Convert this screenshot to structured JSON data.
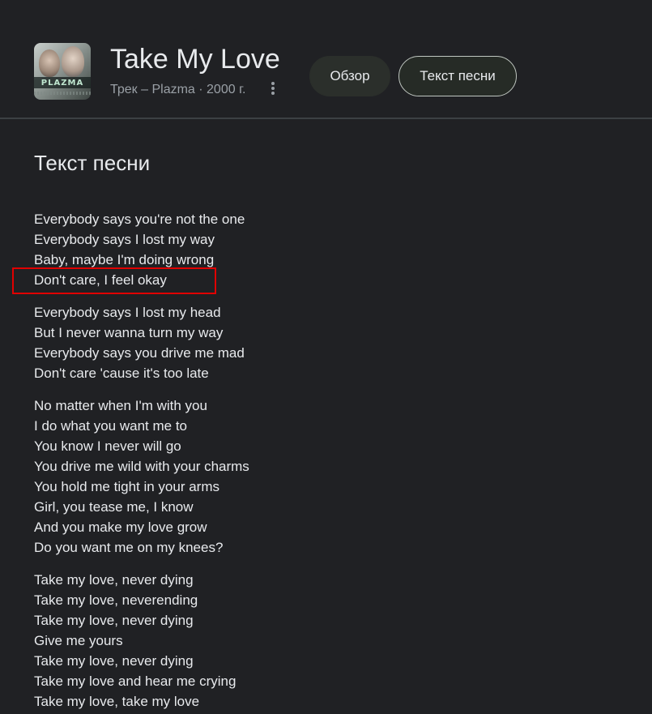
{
  "header": {
    "title": "Take My Love",
    "meta": "Трек – Plazma · 2000 г.",
    "album_art_text": "PLAZMA",
    "more_icon": "more-vert-icon"
  },
  "tabs": [
    {
      "label": "Обзор",
      "selected": false
    },
    {
      "label": "Текст песни",
      "selected": true
    }
  ],
  "section": {
    "title": "Текст песни"
  },
  "lyrics": {
    "stanzas": [
      [
        "Everybody says you're not the one",
        "Everybody says I lost my way",
        "Baby, maybe I'm doing wrong",
        "Don't care, I feel okay"
      ],
      [
        "Everybody says I lost my head",
        "But I never wanna turn my way",
        "Everybody says you drive me mad",
        "Don't care 'cause it's too late"
      ],
      [
        "No matter when I'm with you",
        "I do what you want me to",
        "You know I never will go",
        "You drive me wild with your charms",
        "You hold me tight in your arms",
        "Girl, you tease me, I know",
        "And you make my love grow",
        "Do you want me on my knees?"
      ],
      [
        "Take my love, never dying",
        "Take my love, neverending",
        "Take my love, never dying",
        "Give me yours",
        "Take my love, never dying",
        "Take my love and hear me crying",
        "Take my love, take my love"
      ]
    ]
  },
  "colors": {
    "background": "#202124",
    "text": "#e8eaed",
    "secondary_text": "#9aa0a6",
    "highlight_border": "#e00000"
  }
}
